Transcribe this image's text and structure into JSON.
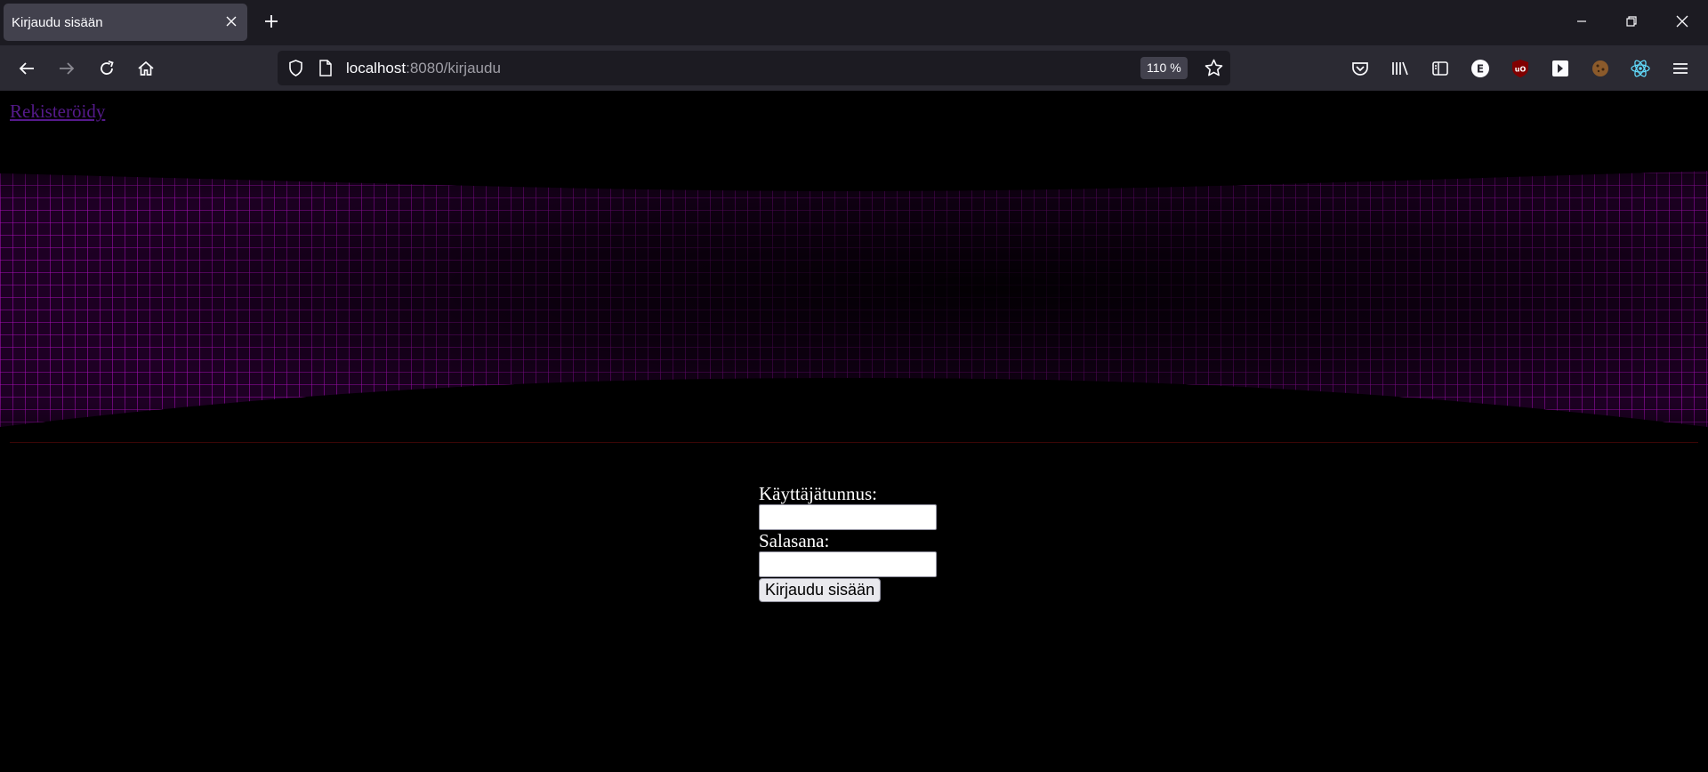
{
  "browser": {
    "tab_title": "Kirjaudu sisään",
    "url_host": "localhost",
    "url_rest": ":8080/kirjaudu",
    "zoom": "110 %",
    "extensions": [
      {
        "name": "pocket-icon"
      },
      {
        "name": "library-icon"
      },
      {
        "name": "sidebar-icon"
      },
      {
        "name": "extension-e-icon",
        "label": "E"
      },
      {
        "name": "ublock-icon",
        "label": "uO"
      },
      {
        "name": "extension-arrow-icon"
      },
      {
        "name": "cookie-icon"
      },
      {
        "name": "react-devtools-icon"
      }
    ]
  },
  "page": {
    "register_link": "Rekisteröidy",
    "banner_color": "#a000b0",
    "form": {
      "username_label": "Käyttäjätunnus:",
      "username_value": "",
      "password_label": "Salasana:",
      "password_value": "",
      "submit_label": "Kirjaudu sisään"
    }
  }
}
